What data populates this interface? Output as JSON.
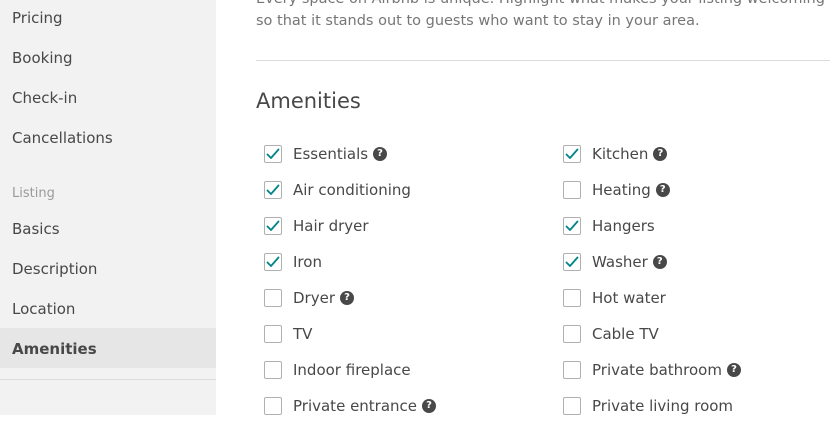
{
  "sidebar": {
    "items_top": [
      {
        "label": "Pricing"
      },
      {
        "label": "Booking"
      },
      {
        "label": "Check-in"
      },
      {
        "label": "Cancellations"
      }
    ],
    "section_label": "Listing",
    "items_listing": [
      {
        "label": "Basics"
      },
      {
        "label": "Description"
      },
      {
        "label": "Location"
      },
      {
        "label": "Amenities",
        "active": true
      }
    ]
  },
  "main": {
    "intro": "Every space on Airbnb is unique. Highlight what makes your listing welcoming so that it stands out to guests who want to stay in your area.",
    "section_title": "Amenities",
    "help_glyph": "?",
    "amenities_left": [
      {
        "label": "Essentials",
        "checked": true,
        "help": true
      },
      {
        "label": "Air conditioning",
        "checked": true,
        "help": false
      },
      {
        "label": "Hair dryer",
        "checked": true,
        "help": false
      },
      {
        "label": "Iron",
        "checked": true,
        "help": false
      },
      {
        "label": "Dryer",
        "checked": false,
        "help": true
      },
      {
        "label": "TV",
        "checked": false,
        "help": false
      },
      {
        "label": "Indoor fireplace",
        "checked": false,
        "help": false
      },
      {
        "label": "Private entrance",
        "checked": false,
        "help": true
      }
    ],
    "amenities_right": [
      {
        "label": "Kitchen",
        "checked": true,
        "help": true
      },
      {
        "label": "Heating",
        "checked": false,
        "help": true
      },
      {
        "label": "Hangers",
        "checked": true,
        "help": false
      },
      {
        "label": "Washer",
        "checked": true,
        "help": true
      },
      {
        "label": "Hot water",
        "checked": false,
        "help": false
      },
      {
        "label": "Cable TV",
        "checked": false,
        "help": false
      },
      {
        "label": "Private bathroom",
        "checked": false,
        "help": true
      },
      {
        "label": "Private living room",
        "checked": false,
        "help": false
      }
    ]
  },
  "colors": {
    "checkmark": "#008489",
    "sidebar_bg": "#f2f2f2",
    "active_bg": "#e6e6e6",
    "text": "#484848",
    "muted": "#767676"
  }
}
